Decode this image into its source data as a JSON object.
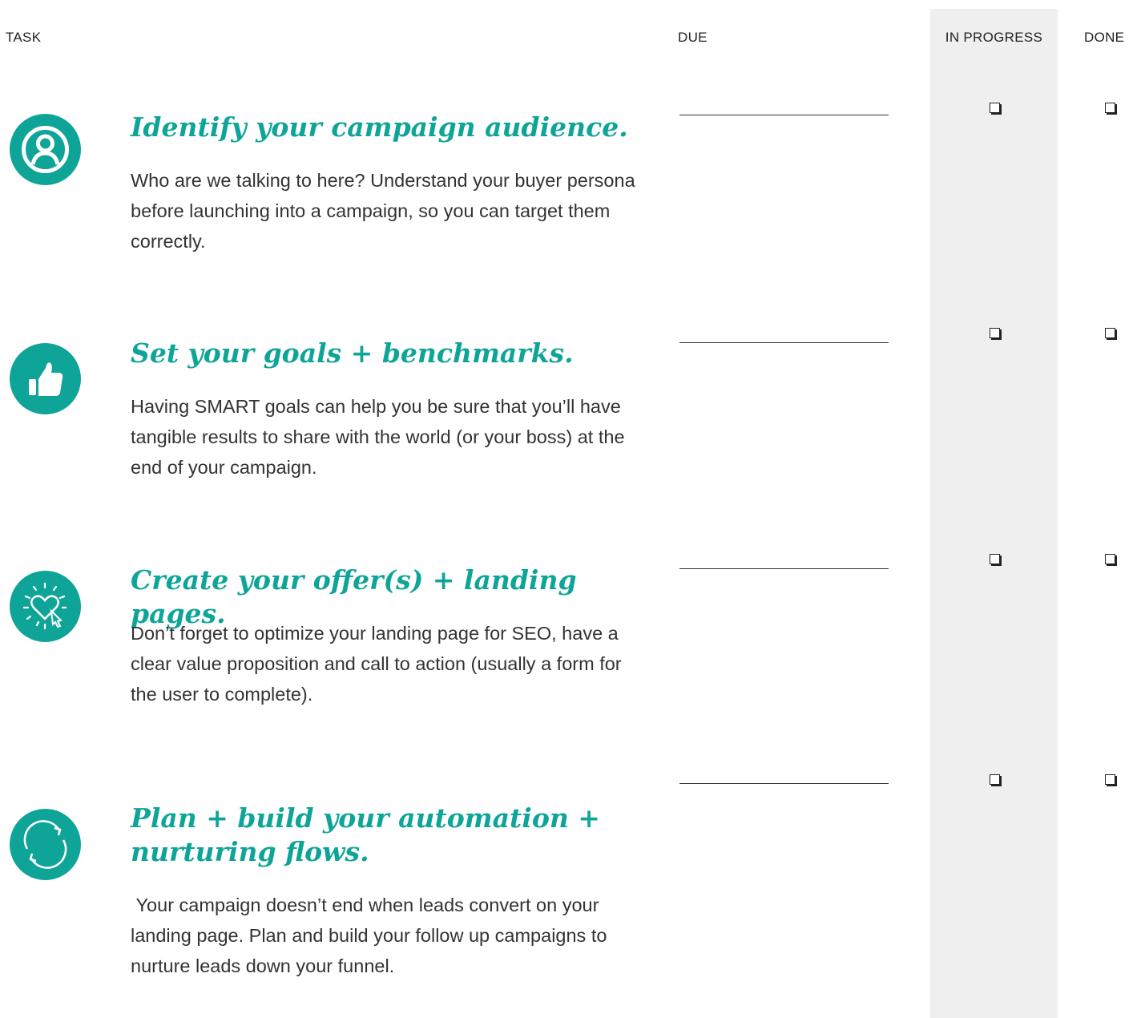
{
  "header": {
    "task": "TASK",
    "due": "DUE",
    "in_progress": "IN PROGRESS",
    "done": "DONE"
  },
  "colors": {
    "accent": "#0ea598",
    "column_bg": "#efefef",
    "text": "#333333"
  },
  "tasks": [
    {
      "icon": "user-circle-icon",
      "title": "Identify your campaign audience.",
      "description": "Who are we talking to here? Understand your buyer persona before launching into a campaign, so you can target them correctly.",
      "in_progress": false,
      "done": false
    },
    {
      "icon": "thumbs-up-icon",
      "title": "Set your goals + benchmarks.",
      "description": "Having SMART goals can help you be sure that you’ll have tangible results to share with the world (or your boss) at the end of your campaign.",
      "in_progress": false,
      "done": false
    },
    {
      "icon": "heart-cursor-icon",
      "title": "Create your offer(s) + landing pages.",
      "description": "Don’t forget to optimize your landing page for SEO, have a clear value proposition and call to action (usually a form for the user to complete).",
      "in_progress": false,
      "done": false
    },
    {
      "icon": "refresh-cycle-icon",
      "title": "Plan + build your automation + nurturing flows.",
      "description": " Your campaign doesn’t end when leads convert on your landing page. Plan and build your follow up campaigns to nurture leads down your funnel.",
      "in_progress": false,
      "done": false
    }
  ]
}
